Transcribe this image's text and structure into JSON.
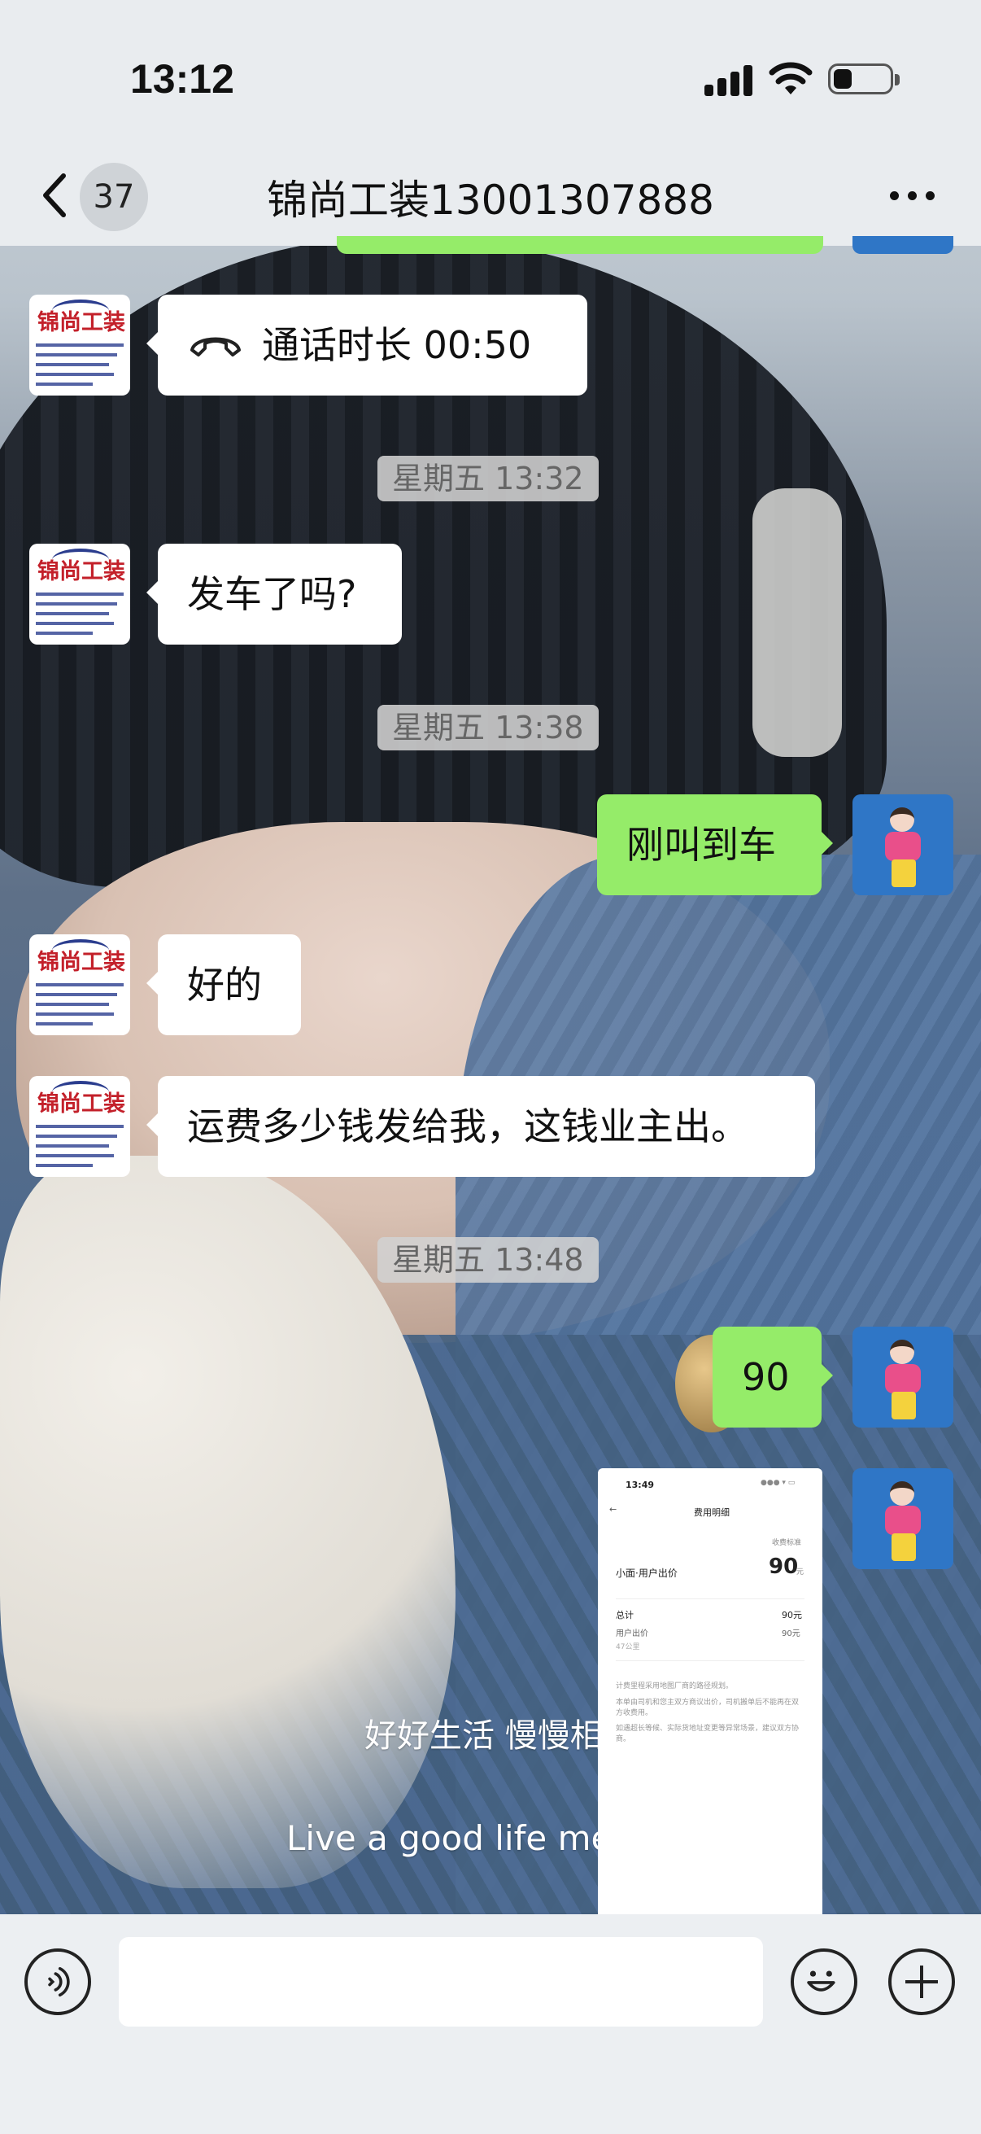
{
  "status_bar": {
    "time": "13:12"
  },
  "header": {
    "unread_count": "37",
    "title": "锦尚工装13001307888"
  },
  "messages": [
    {
      "type": "call",
      "side": "in",
      "text": "通话时长 00:50"
    },
    {
      "type": "timestamp",
      "text": "星期五 13:32"
    },
    {
      "type": "text",
      "side": "in",
      "text": "发车了吗?"
    },
    {
      "type": "timestamp",
      "text": "星期五 13:38"
    },
    {
      "type": "text",
      "side": "out",
      "text": "刚叫到车"
    },
    {
      "type": "text",
      "side": "in",
      "text": "好的"
    },
    {
      "type": "text",
      "side": "in",
      "text": "运费多少钱发给我，这钱业主出。"
    },
    {
      "type": "timestamp",
      "text": "星期五 13:48"
    },
    {
      "type": "text",
      "side": "out",
      "text": "90"
    },
    {
      "type": "image",
      "side": "out"
    }
  ],
  "image_message": {
    "time": "13:49",
    "title": "费用明细",
    "tag": "收费标准",
    "service": "小面·用户出价",
    "price": "90",
    "price_unit": "元",
    "total_label": "总计",
    "total_value": "90元",
    "user_bid_label": "用户出价",
    "user_bid_value": "90元",
    "distance": "47公里",
    "note1": "计费里程采用地图厂商的路径规划。",
    "note2": "本单由司机和您主双方商议出价，司机搬单后不能再在双方收费用。",
    "note3": "如遇超长等候、实际货地址变更等异常场景，建议双方协商。"
  },
  "background_text": {
    "cn": "好好生活 慢慢相遇",
    "en": "Live a good life mee"
  },
  "contact_avatar": {
    "logo": "锦尚工装"
  },
  "colors": {
    "outgoing_bubble": "#95ec69",
    "incoming_bubble": "#ffffff",
    "bar_bg": "#e9ecef"
  }
}
